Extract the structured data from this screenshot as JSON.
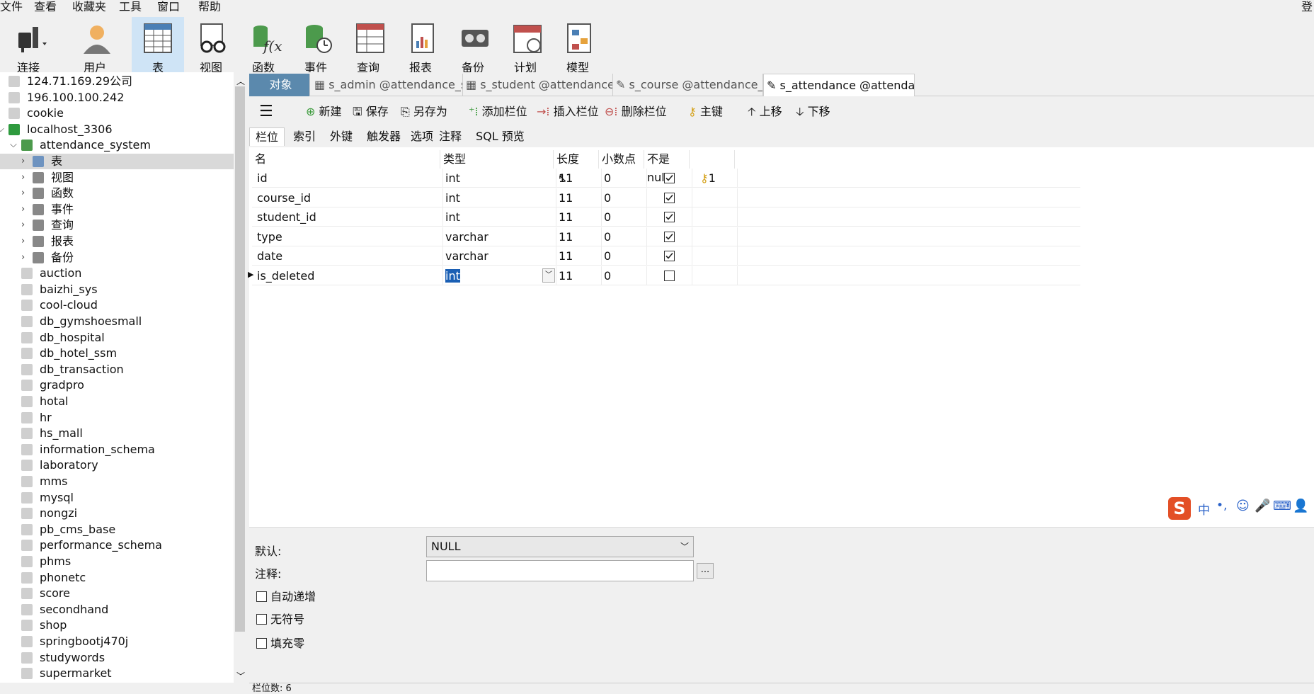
{
  "menu": [
    "文件",
    "查看",
    "收藏夹",
    "工具",
    "窗口",
    "帮助",
    "登"
  ],
  "toolbar": {
    "items": [
      {
        "label": "连接",
        "icon": "connect-plug-icon"
      },
      {
        "label": "用户",
        "icon": "user-icon"
      },
      {
        "label": "表",
        "icon": "table-icon"
      },
      {
        "label": "视图",
        "icon": "view-glasses-icon"
      },
      {
        "label": "函数",
        "icon": "function-icon"
      },
      {
        "label": "事件",
        "icon": "event-clock-icon"
      },
      {
        "label": "查询",
        "icon": "query-icon"
      },
      {
        "label": "报表",
        "icon": "report-icon"
      },
      {
        "label": "备份",
        "icon": "backup-icon"
      },
      {
        "label": "计划",
        "icon": "schedule-calendar-icon"
      },
      {
        "label": "模型",
        "icon": "model-icon"
      }
    ]
  },
  "sidebar": {
    "connections": [
      "124.71.169.29公司",
      "196.100.100.242",
      "cookie",
      "localhost_3306"
    ],
    "database": "attendance_system",
    "children": [
      "表",
      "视图",
      "函数",
      "事件",
      "查询",
      "报表",
      "备份"
    ],
    "databases": [
      "auction",
      "baizhi_sys",
      "cool-cloud",
      "db_gymshoesmall",
      "db_hospital",
      "db_hotel_ssm",
      "db_transaction",
      "gradpro",
      "hotal",
      "hr",
      "hs_mall",
      "information_schema",
      "laboratory",
      "mms",
      "mysql",
      "nongzi",
      "pb_cms_base",
      "performance_schema",
      "phms",
      "phonetc",
      "score",
      "secondhand",
      "shop",
      "springbootj470j",
      "studywords",
      "supermarket"
    ]
  },
  "tabs": [
    "对象",
    "s_admin @attendance_syste...",
    "s_student @attendance_syst...",
    "s_course @attendance_syst...",
    "s_attendance @attendance_..."
  ],
  "edit_toolbar": [
    "新建",
    "保存",
    "另存为",
    "添加栏位",
    "插入栏位",
    "删除栏位",
    "主键",
    "上移",
    "下移"
  ],
  "subtabs": [
    "栏位",
    "索引",
    "外键",
    "触发器",
    "选项",
    "注释",
    "SQL 预览"
  ],
  "grid": {
    "headers": [
      "名",
      "类型",
      "长度",
      "小数点",
      "不是 null",
      ""
    ],
    "rows": [
      {
        "name": "id",
        "type": "int",
        "length": "11",
        "decimal": "0",
        "notnull": true,
        "key": "1"
      },
      {
        "name": "course_id",
        "type": "int",
        "length": "11",
        "decimal": "0",
        "notnull": true,
        "key": ""
      },
      {
        "name": "student_id",
        "type": "int",
        "length": "11",
        "decimal": "0",
        "notnull": true,
        "key": ""
      },
      {
        "name": "type",
        "type": "varchar",
        "length": "11",
        "decimal": "0",
        "notnull": true,
        "key": ""
      },
      {
        "name": "date",
        "type": "varchar",
        "length": "11",
        "decimal": "0",
        "notnull": true,
        "key": ""
      },
      {
        "name": "is_deleted",
        "type": "int",
        "length": "11",
        "decimal": "0",
        "notnull": false,
        "key": ""
      }
    ]
  },
  "props": {
    "default_label": "默认:",
    "default_value": "NULL",
    "comment_label": "注释:",
    "ellipsis": "...",
    "checks": [
      "自动递增",
      "无符号",
      "填充零"
    ]
  },
  "status": {
    "text": "栏位数: 6"
  },
  "ime": {
    "label1": "中",
    "label2": "•,"
  }
}
